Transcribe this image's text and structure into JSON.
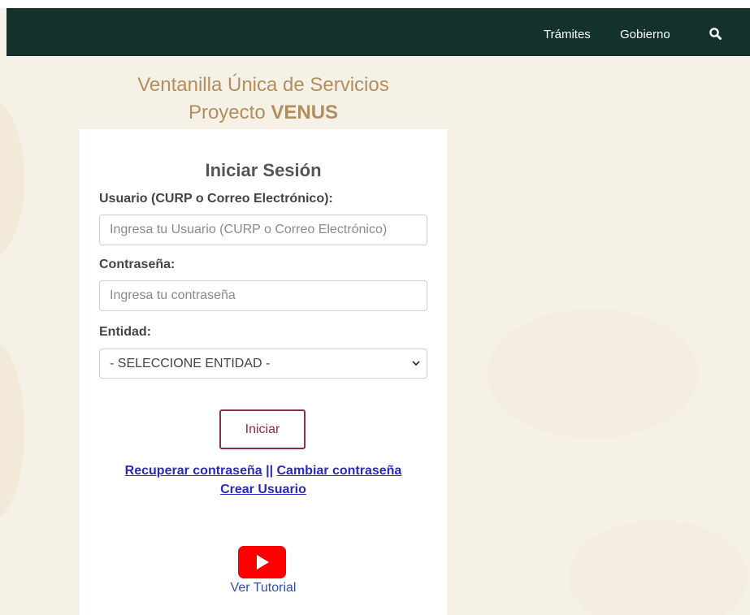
{
  "nav": {
    "items": [
      {
        "label": "Trámites"
      },
      {
        "label": "Gobierno"
      }
    ],
    "search_icon": "search-icon"
  },
  "header": {
    "line1": "Ventanilla Única de Servicios",
    "line2_prefix": "Proyecto ",
    "line2_bold": "VENUS"
  },
  "login": {
    "title": "Iniciar Sesión",
    "user_label": "Usuario (CURP o Correo Electrónico):",
    "user_placeholder": "Ingresa tu Usuario (CURP o Correo Electrónico)",
    "user_value": "",
    "password_label": "Contraseña:",
    "password_placeholder": "Ingresa tu contraseña",
    "password_value": "",
    "entity_label": "Entidad:",
    "entity_selected": "- SELECCIONE ENTIDAD -",
    "submit_label": "Iniciar"
  },
  "links": {
    "recover": "Recuperar contraseña",
    "separator": " || ",
    "change": "Cambiar contraseña",
    "create": "Crear Usuario"
  },
  "tutorial": {
    "icon": "youtube-play-icon",
    "label": "Ver Tutorial"
  },
  "colors": {
    "navbar": "#13322b",
    "accent_gold": "#b38e5d",
    "button_border": "#8b2b4d",
    "link": "#2a2ab8",
    "youtube_red": "#ff0000",
    "background": "#f6f1e7"
  }
}
